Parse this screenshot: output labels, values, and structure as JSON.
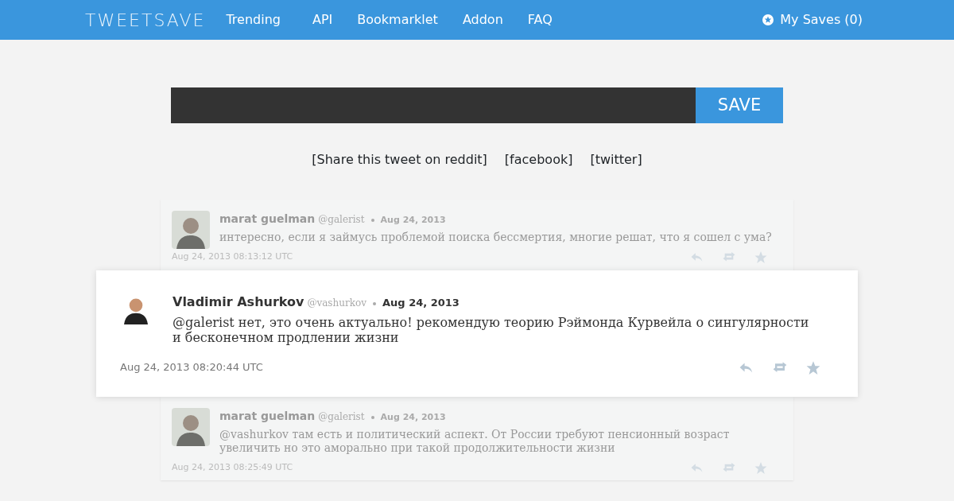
{
  "navbar": {
    "logo": "TWEETSAVE",
    "links": [
      {
        "label": "Trending"
      },
      {
        "label": "API"
      },
      {
        "label": "Bookmarklet"
      },
      {
        "label": "Addon"
      },
      {
        "label": "FAQ"
      }
    ],
    "saves": "My Saves (0)"
  },
  "save_form": {
    "button": "SAVE"
  },
  "share_links": [
    {
      "label": "[Share this tweet on reddit]"
    },
    {
      "label": "[facebook]"
    },
    {
      "label": "[twitter]"
    }
  ],
  "tweets": [
    {
      "kind": "context",
      "name": "marat guelman",
      "handle": "@galerist",
      "date": "Aug 24, 2013",
      "text": "интересно, если я займусь проблемой поиска бессмертия, многие решат, что я сошел с ума?",
      "timestamp": "Aug 24, 2013 08:13:12 UTC"
    },
    {
      "kind": "focus",
      "name": "Vladimir Ashurkov",
      "handle": "@vashurkov",
      "date": "Aug 24, 2013",
      "text": "@galerist нет, это очень актуально! рекомендую теорию Рэймонда Курвейла о сингулярности и бесконечном продлении жизни",
      "timestamp": "Aug 24, 2013 08:20:44 UTC"
    },
    {
      "kind": "context",
      "name": "marat guelman",
      "handle": "@galerist",
      "date": "Aug 24, 2013",
      "text": "@vashurkov там есть и политический аспект. От России требуют пенсионный возраст увеличить но это аморально при такой продолжительности жизни",
      "timestamp": "Aug 24, 2013 08:25:49 UTC"
    }
  ]
}
